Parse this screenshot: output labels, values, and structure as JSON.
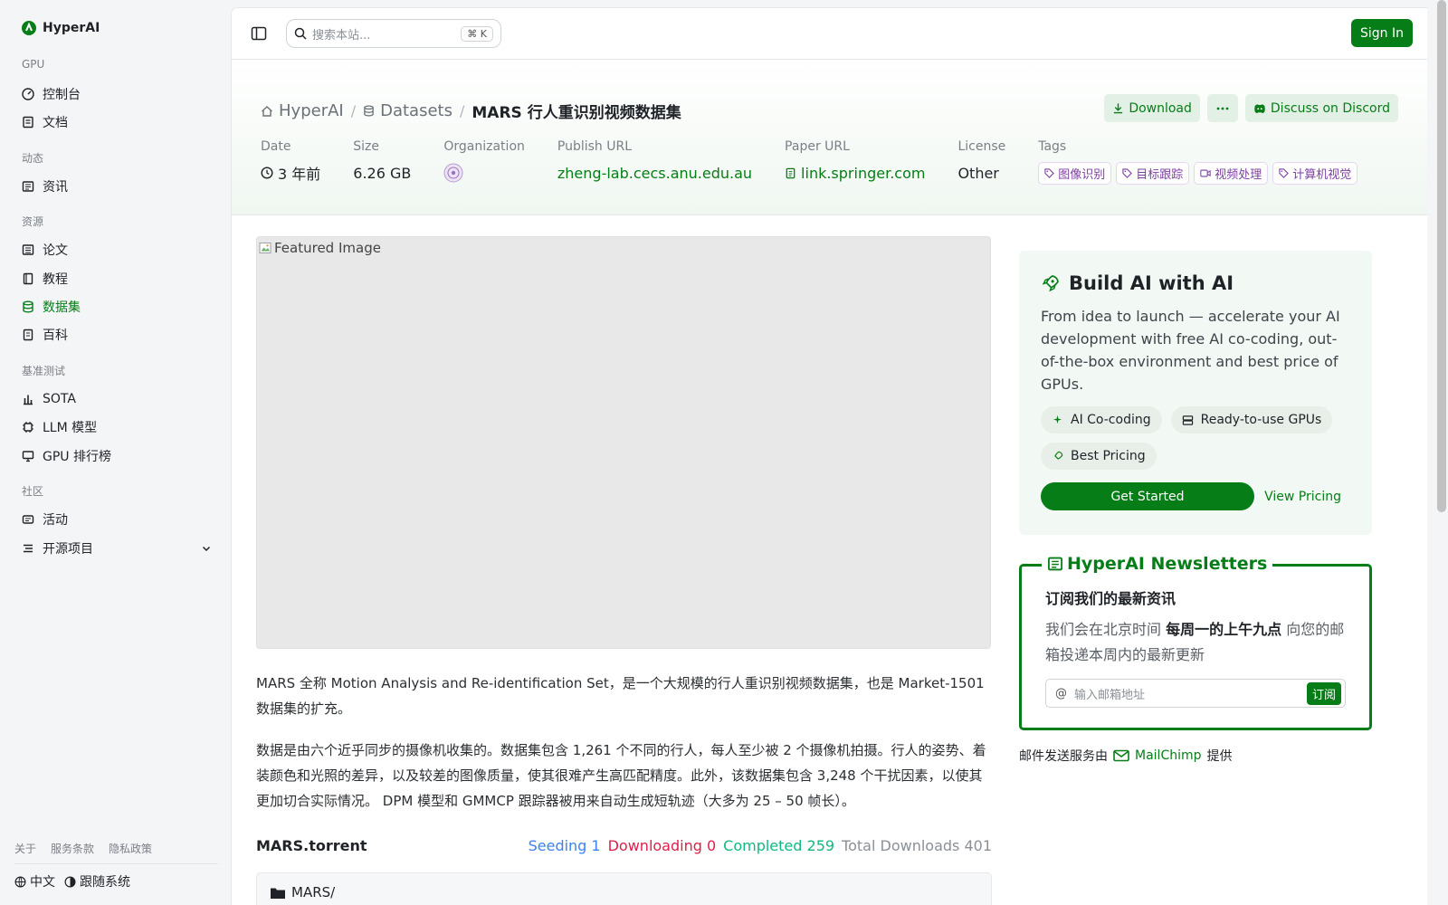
{
  "brand": {
    "name": "HyperAI"
  },
  "sidebar": {
    "sections": [
      {
        "label": "GPU",
        "items": [
          {
            "label": "控制台",
            "icon": "gauge-icon"
          },
          {
            "label": "文档",
            "icon": "book-icon"
          }
        ]
      },
      {
        "label": "动态",
        "items": [
          {
            "label": "资讯",
            "icon": "newspaper-icon"
          }
        ]
      },
      {
        "label": "资源",
        "items": [
          {
            "label": "论文",
            "icon": "list-icon"
          },
          {
            "label": "教程",
            "icon": "notebook-icon"
          },
          {
            "label": "数据集",
            "icon": "database-icon",
            "active": true
          },
          {
            "label": "百科",
            "icon": "wiki-icon"
          }
        ]
      },
      {
        "label": "基准测试",
        "items": [
          {
            "label": "SOTA",
            "icon": "bar-chart-icon"
          },
          {
            "label": "LLM 模型",
            "icon": "chip-icon"
          },
          {
            "label": "GPU 排行榜",
            "icon": "monitor-icon"
          }
        ]
      },
      {
        "label": "社区",
        "items": [
          {
            "label": "活动",
            "icon": "ticket-icon"
          },
          {
            "label": "开源项目",
            "icon": "menu-icon"
          }
        ]
      }
    ],
    "footer_links": [
      "关于",
      "服务条款",
      "隐私政策"
    ],
    "language": "中文",
    "theme": "跟随系统"
  },
  "topbar": {
    "search_placeholder": "搜索本站...",
    "shortcut_key": "K",
    "signin_label": "Sign In"
  },
  "breadcrumb": {
    "home": "HyperAI",
    "section": "Datasets",
    "current": "MARS 行人重识别视频数据集"
  },
  "actions": {
    "download_label": "Download",
    "discord_label": "Discuss on Discord"
  },
  "meta": {
    "date_label": "Date",
    "date_value": "3 年前",
    "size_label": "Size",
    "size_value": "6.26 GB",
    "org_label": "Organization",
    "publish_label": "Publish URL",
    "publish_value": "zheng-lab.cecs.anu.edu.au",
    "paper_label": "Paper URL",
    "paper_value": "link.springer.com",
    "license_label": "License",
    "license_value": "Other",
    "tags_label": "Tags",
    "tags": [
      "图像识别",
      "目标跟踪",
      "视频处理",
      "计算机视觉"
    ]
  },
  "featured": {
    "alt": "Featured Image"
  },
  "description": {
    "p1": "MARS 全称 Motion Analysis and Re-identification Set，是一个大规模的行人重识别视频数据集，也是 Market-1501 数据集的扩充。",
    "p2": "数据是由六个近乎同步的摄像机收集的。数据集包含 1,261 个不同的行人，每人至少被 2 个摄像机拍摄。行人的姿势、着装颜色和光照的差异，以及较差的图像质量，使其很难产生高匹配精度。此外，该数据集包含 3,248 个干扰因素，以使其更加切合实际情况。 DPM 模型和 GMMCP 跟踪器被用来自动生成短轨迹（大多为 25 – 50 帧长）。"
  },
  "torrent": {
    "name": "MARS.torrent",
    "seeding": "Seeding 1",
    "downloading": "Downloading 0",
    "completed": "Completed 259",
    "total": "Total Downloads 401",
    "folder": "MARS/"
  },
  "promo": {
    "title": "Build AI with AI",
    "body": "From idea to launch — accelerate your AI development with free AI co-coding, out-of-the-box environment and best price of GPUs.",
    "pills": [
      "AI Co-coding",
      "Ready-to-use GPUs",
      "Best Pricing"
    ],
    "cta": "Get Started",
    "pricing": "View Pricing"
  },
  "newsletter": {
    "title": "HyperAI Newsletters",
    "subtitle": "订阅我们的最新资讯",
    "body_pre": "我们会在北京时间 ",
    "body_bold": "每周一的上午九点",
    "body_post": " 向您的邮箱投递本周内的最新更新",
    "email_placeholder": "输入邮箱地址",
    "subscribe_label": "订阅",
    "mail_note_pre": "邮件发送服务由",
    "mail_note_brand": "MailChimp",
    "mail_note_post": "提供"
  },
  "colors": {
    "accent": "#067d17",
    "seeding": "#3b82f6",
    "downloading": "#e11d48",
    "completed": "#10b981",
    "tag": "#7b3fa0"
  }
}
